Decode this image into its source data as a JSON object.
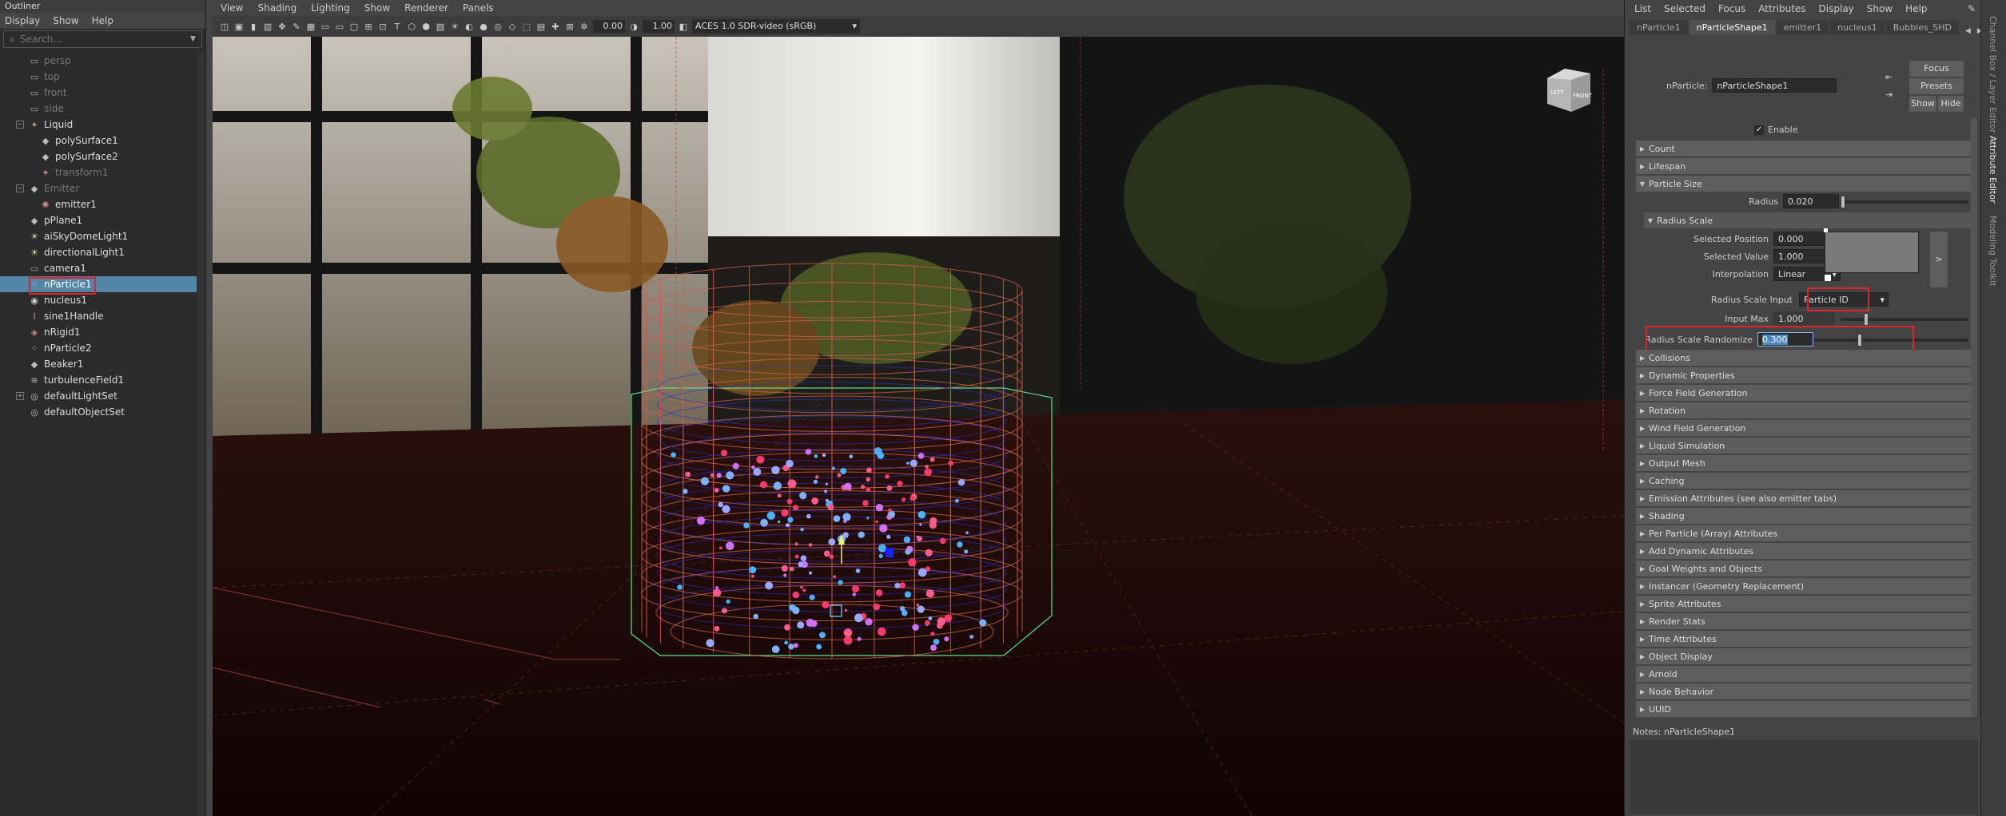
{
  "outliner": {
    "title": "Outliner",
    "menu": [
      "Display",
      "Show",
      "Help"
    ],
    "search_placeholder": "Search...",
    "items": [
      {
        "label": "persp",
        "indent": 0,
        "dim": true,
        "icon": "camera"
      },
      {
        "label": "top",
        "indent": 0,
        "dim": true,
        "icon": "camera"
      },
      {
        "label": "front",
        "indent": 0,
        "dim": true,
        "icon": "camera"
      },
      {
        "label": "side",
        "indent": 0,
        "dim": true,
        "icon": "camera"
      },
      {
        "label": "Liquid",
        "indent": 0,
        "dim": false,
        "icon": "transform",
        "expand": "−"
      },
      {
        "label": "polySurface1",
        "indent": 1,
        "dim": false,
        "icon": "mesh"
      },
      {
        "label": "polySurface2",
        "indent": 1,
        "dim": false,
        "icon": "mesh"
      },
      {
        "label": "transform1",
        "indent": 1,
        "dim": true,
        "icon": "transform"
      },
      {
        "label": "Emitter",
        "indent": 0,
        "dim": true,
        "icon": "mesh",
        "expand": "−"
      },
      {
        "label": "emitter1",
        "indent": 1,
        "dim": false,
        "icon": "emitter"
      },
      {
        "label": "pPlane1",
        "indent": 0,
        "dim": false,
        "icon": "mesh"
      },
      {
        "label": "aiSkyDomeLight1",
        "indent": 0,
        "dim": false,
        "icon": "light"
      },
      {
        "label": "directionalLight1",
        "indent": 0,
        "dim": false,
        "icon": "light"
      },
      {
        "label": "camera1",
        "indent": 0,
        "dim": false,
        "icon": "camera"
      },
      {
        "label": "nParticle1",
        "indent": 0,
        "dim": false,
        "icon": "particle",
        "selected": true
      },
      {
        "label": "nucleus1",
        "indent": 0,
        "dim": false,
        "icon": "nucleus"
      },
      {
        "label": "sine1Handle",
        "indent": 0,
        "dim": false,
        "icon": "deformer"
      },
      {
        "label": "nRigid1",
        "indent": 0,
        "dim": false,
        "icon": "rigid"
      },
      {
        "label": "nParticle2",
        "indent": 0,
        "dim": false,
        "icon": "particle"
      },
      {
        "label": "Beaker1",
        "indent": 0,
        "dim": false,
        "icon": "mesh"
      },
      {
        "label": "turbulenceField1",
        "indent": 0,
        "dim": false,
        "icon": "field"
      },
      {
        "label": "defaultLightSet",
        "indent": 0,
        "dim": false,
        "icon": "set",
        "expand": "+"
      },
      {
        "label": "defaultObjectSet",
        "indent": 0,
        "dim": false,
        "icon": "set"
      }
    ]
  },
  "viewport": {
    "menu": [
      "View",
      "Shading",
      "Lighting",
      "Show",
      "Renderer",
      "Panels"
    ],
    "exposure": "0.00",
    "gamma": "1.00",
    "color_space": "ACES 1.0 SDR-video (sRGB)",
    "viewcube": {
      "left": "LEFT",
      "front": "FRONT"
    }
  },
  "attribute_editor": {
    "menu": [
      "List",
      "Selected",
      "Focus",
      "Attributes",
      "Display",
      "Show",
      "Help"
    ],
    "tabs": [
      "nParticle1",
      "nParticleShape1",
      "emitter1",
      "nucleus1",
      "Bubbles_SHD"
    ],
    "active_tab": 1,
    "node_label": "nParticle:",
    "node_value": "nParticleShape1",
    "buttons": {
      "focus": "Focus",
      "presets": "Presets",
      "show": "Show",
      "hide": "Hide"
    },
    "enable_label": "Enable",
    "sections_top": [
      "Count",
      "Lifespan"
    ],
    "particle_size": {
      "title": "Particle Size",
      "radius_label": "Radius",
      "radius_value": "0.020",
      "radius_slider_fraction": 0.02,
      "radius_scale": {
        "title": "Radius Scale",
        "selected_position_label": "Selected Position",
        "selected_position": "0.000",
        "selected_value_label": "Selected Value",
        "selected_value": "1.000",
        "interpolation_label": "Interpolation",
        "interpolation": "Linear",
        "ramp_button": ">"
      },
      "radius_scale_input_label": "Radius Scale Input",
      "radius_scale_input": "Particle ID",
      "input_max_label": "Input Max",
      "input_max": "1.000",
      "input_max_slider_fraction": 0.2,
      "radius_scale_randomize_label": "Radius Scale Randomize",
      "radius_scale_randomize": "0.300",
      "randomize_slider_fraction": 0.3
    },
    "sections_bottom": [
      "Collisions",
      "Dynamic Properties",
      "Force Field Generation",
      "Rotation",
      "Wind Field Generation",
      "Liquid Simulation",
      "Output Mesh",
      "Caching",
      "Emission Attributes (see also emitter tabs)",
      "Shading",
      "Per Particle (Array) Attributes",
      "Add Dynamic Attributes",
      "Goal Weights and Objects",
      "Instancer (Geometry Replacement)",
      "Sprite Attributes",
      "Render Stats",
      "Time Attributes",
      "Object Display",
      "Arnold",
      "Node Behavior",
      "UUID"
    ],
    "notes": "Notes:  nParticleShape1"
  },
  "side_strip": {
    "tabs": [
      "Channel Box / Layer Editor",
      "Attribute Editor",
      "Modeling Toolkit"
    ],
    "active": 1
  },
  "colors": {
    "selection": "#5285a6",
    "highlight": "#e0242b",
    "wireframe": "#c8604a",
    "bounding": "#5fe08a"
  }
}
